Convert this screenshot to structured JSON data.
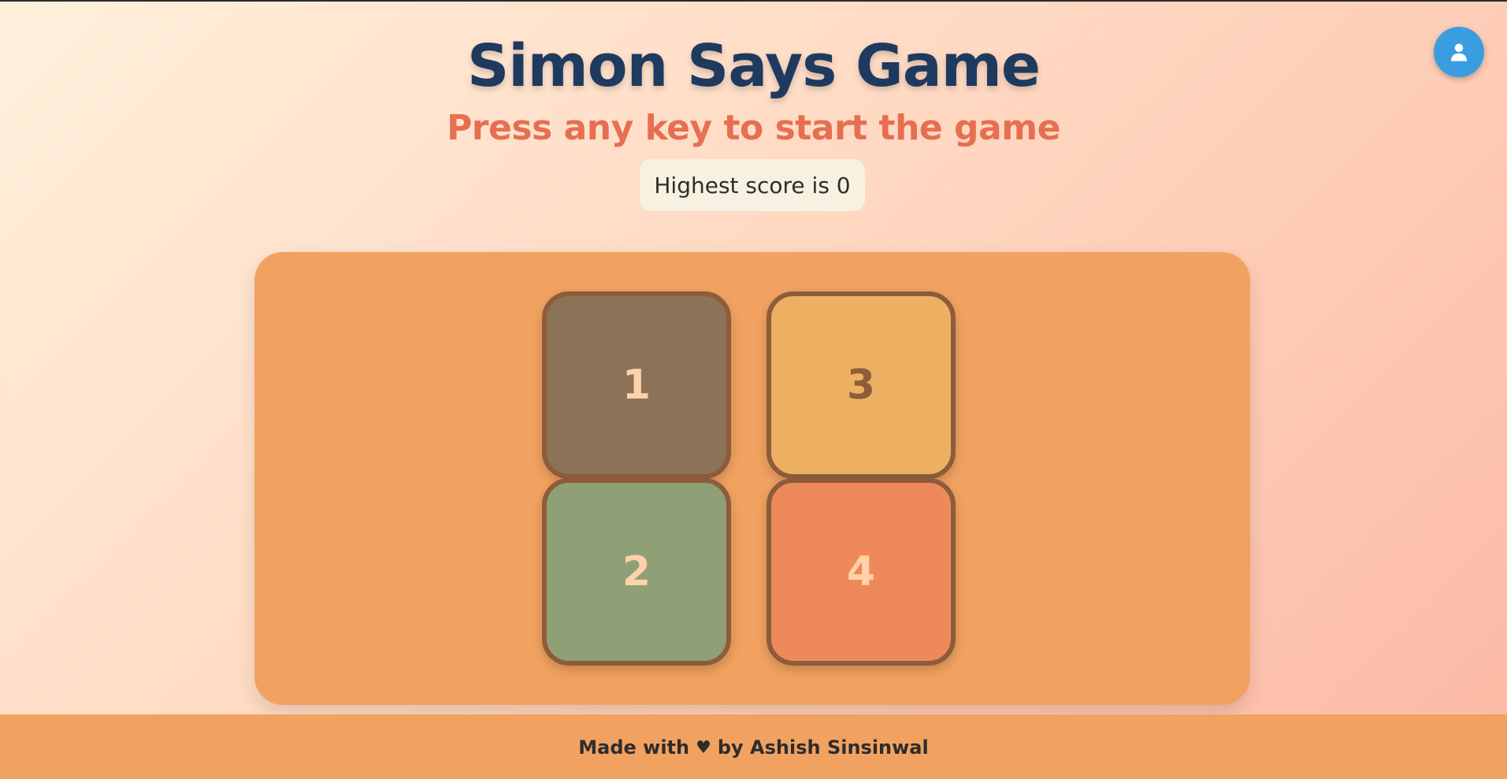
{
  "header": {
    "title": "Simon Says Game",
    "subtitle": "Press any key to start the game",
    "score_text": "Highest score is 0"
  },
  "user_button": {
    "icon": "user-icon",
    "color": "#3a9de0"
  },
  "board": {
    "tiles": [
      {
        "label": "1",
        "color": "#8c7357"
      },
      {
        "label": "3",
        "color": "#edb062"
      },
      {
        "label": "2",
        "color": "#8fa077"
      },
      {
        "label": "4",
        "color": "#ed895a"
      }
    ]
  },
  "footer": {
    "prefix": "Made with",
    "heart": "♥",
    "suffix": "by Ashish Sinsinwal"
  },
  "colors": {
    "title": "#1f3a5f",
    "subtitle": "#e66f52",
    "board": "#f2a260",
    "tile_border": "#8d5c3a"
  }
}
